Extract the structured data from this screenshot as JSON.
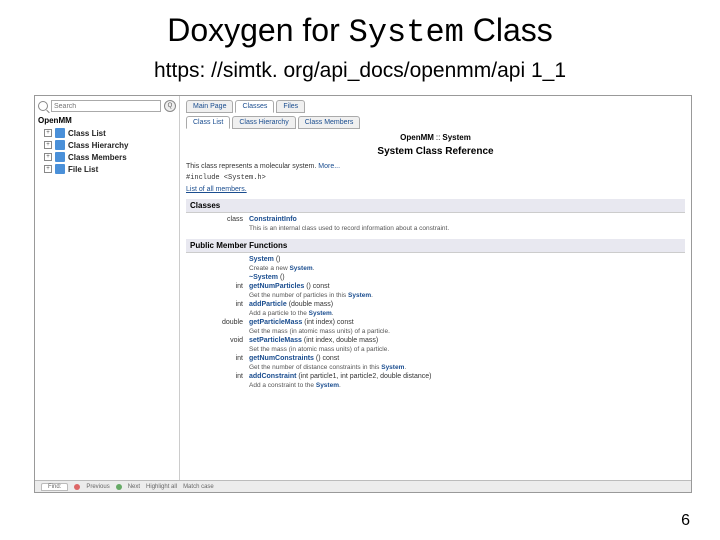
{
  "slide": {
    "title_prefix": "Doxygen for ",
    "title_mono": "System",
    "title_suffix": " Class",
    "url": "https: //simtk. org/api_docs/openmm/api 1_1",
    "page_number": "6"
  },
  "sidebar": {
    "search_placeholder": "Search",
    "search_btn": "Q",
    "root": "OpenMM",
    "items": [
      {
        "label": "Class List"
      },
      {
        "label": "Class Hierarchy"
      },
      {
        "label": "Class Members"
      },
      {
        "label": "File List"
      }
    ]
  },
  "tabs_row1": [
    {
      "label": "Main Page"
    },
    {
      "label": "Classes"
    },
    {
      "label": "Files"
    }
  ],
  "tabs_row2": [
    {
      "label": "Class List"
    },
    {
      "label": "Class Hierarchy"
    },
    {
      "label": "Class Members"
    }
  ],
  "breadcrumb": {
    "ns": "OpenMM",
    "sep": "::",
    "cls": "System"
  },
  "heading": "System Class Reference",
  "description": {
    "text": "This class represents a molecular system. ",
    "more": "More..."
  },
  "include": "#include <System.h>",
  "members_link": "List of all members.",
  "sections": {
    "classes": {
      "title": "Classes",
      "rows": [
        {
          "ret": "class",
          "name": "ConstraintInfo",
          "sig": "",
          "desc": "This is an internal class used to record information about a constraint."
        }
      ]
    },
    "functions": {
      "title": "Public Member Functions",
      "rows": [
        {
          "ret": "",
          "name": "System",
          "sig": " ()",
          "desc_pre": "Create a new ",
          "desc_sys": "System",
          "desc_post": "."
        },
        {
          "ret": "",
          "name": "~System",
          "sig": " ()",
          "desc_pre": "",
          "desc_sys": "",
          "desc_post": ""
        },
        {
          "ret": "int",
          "name": "getNumParticles",
          "sig": " () const",
          "desc_pre": "Get the number of particles in this ",
          "desc_sys": "System",
          "desc_post": "."
        },
        {
          "ret": "int",
          "name": "addParticle",
          "sig": " (double mass)",
          "desc_pre": "Add a particle to the ",
          "desc_sys": "System",
          "desc_post": "."
        },
        {
          "ret": "double",
          "name": "getParticleMass",
          "sig": " (int index) const",
          "desc_pre": "Get the mass (in atomic mass units) of a particle.",
          "desc_sys": "",
          "desc_post": ""
        },
        {
          "ret": "void",
          "name": "setParticleMass",
          "sig": " (int index, double mass)",
          "desc_pre": "Set the mass (in atomic mass units) of a particle.",
          "desc_sys": "",
          "desc_post": ""
        },
        {
          "ret": "int",
          "name": "getNumConstraints",
          "sig": " () const",
          "desc_pre": "Get the number of distance constraints in this ",
          "desc_sys": "System",
          "desc_post": "."
        },
        {
          "ret": "int",
          "name": "addConstraint",
          "sig": " (int particle1, int particle2, double distance)",
          "desc_pre": "Add a constraint to the ",
          "desc_sys": "System",
          "desc_post": "."
        }
      ]
    }
  },
  "footer": {
    "tab": "Find:",
    "items": [
      "Previous",
      "Next",
      "Highlight all",
      "Match case"
    ]
  }
}
